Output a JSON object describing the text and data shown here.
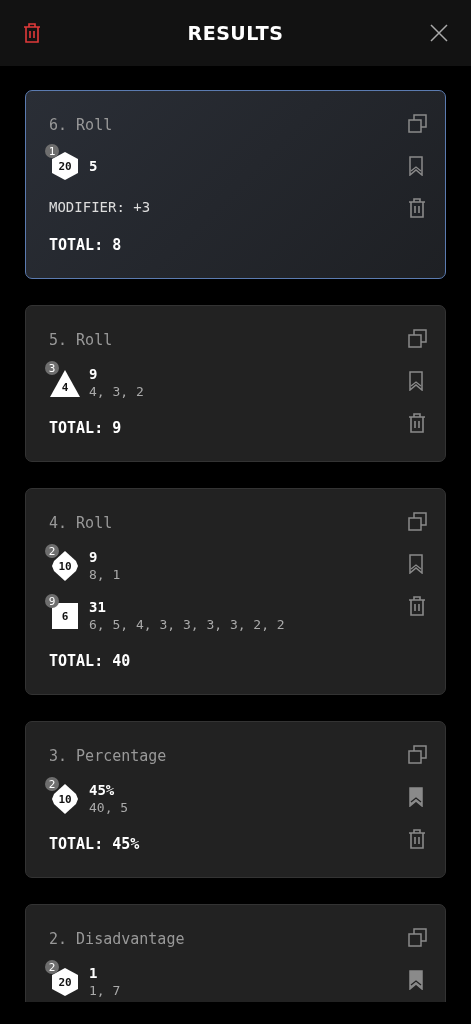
{
  "header": {
    "title": "RESULTS"
  },
  "results": [
    {
      "title": "6. Roll",
      "selected": true,
      "bookmarked": false,
      "rolls": [
        {
          "kind": "hexagon",
          "sides": "20",
          "count": "1",
          "result": "5"
        }
      ],
      "modifier": "MODIFIER: +3",
      "total": "TOTAL: 8"
    },
    {
      "title": "5. Roll",
      "selected": false,
      "bookmarked": false,
      "rolls": [
        {
          "kind": "triangle",
          "sides": "4",
          "count": "3",
          "result": "9",
          "detail": "4, 3, 2"
        }
      ],
      "total": "TOTAL: 9"
    },
    {
      "title": "4. Roll",
      "selected": false,
      "bookmarked": false,
      "rolls": [
        {
          "kind": "diamond",
          "sides": "10",
          "count": "2",
          "result": "9",
          "detail": "8, 1"
        },
        {
          "kind": "square",
          "sides": "6",
          "count": "9",
          "result": "31",
          "detail": "6, 5, 4, 3, 3, 3, 3, 2, 2"
        }
      ],
      "total": "TOTAL: 40"
    },
    {
      "title": "3. Percentage",
      "selected": false,
      "bookmarked": true,
      "rolls": [
        {
          "kind": "diamond",
          "sides": "10",
          "count": "2",
          "result": "45%",
          "detail": "40, 5"
        }
      ],
      "total": "TOTAL: 45%"
    },
    {
      "title": "2. Disadvantage",
      "selected": false,
      "bookmarked": true,
      "rolls": [
        {
          "kind": "hexagon",
          "sides": "20",
          "count": "2",
          "result": "1",
          "detail": "1, 7"
        }
      ]
    }
  ]
}
